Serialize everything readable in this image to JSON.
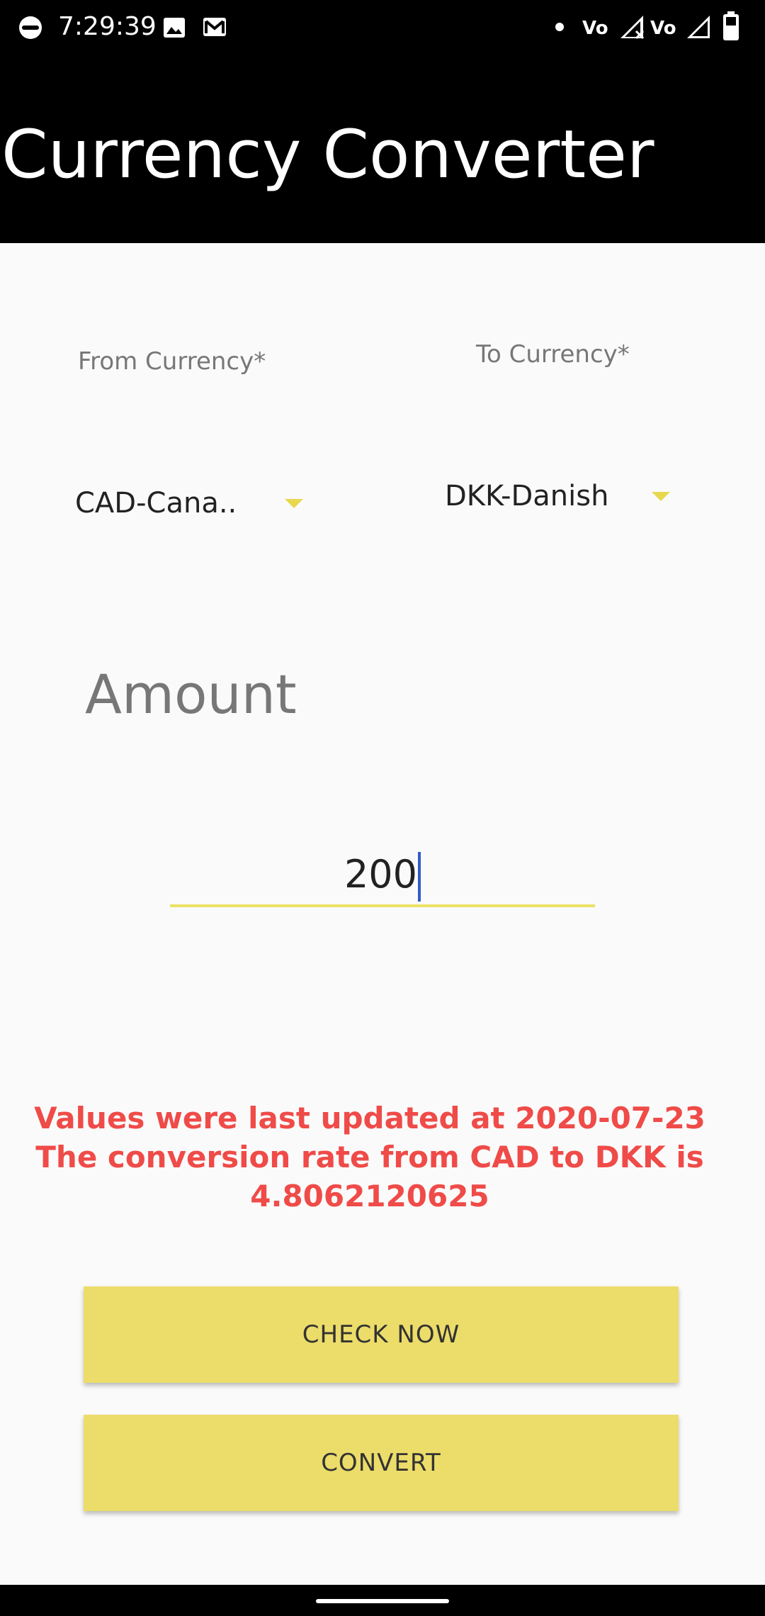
{
  "status_bar": {
    "time": "7:29:39",
    "icons": [
      "incognito-icon",
      "image-icon",
      "gmail-icon",
      "notification-dot-icon",
      "volte-icon",
      "signal-x-icon",
      "volte-icon",
      "signal-icon",
      "battery-icon"
    ]
  },
  "app_bar": {
    "title": "Currency Converter"
  },
  "from_currency": {
    "label": "From Currency*",
    "value": "CAD-Cana.."
  },
  "to_currency": {
    "label": "To Currency*",
    "value": "DKK-Danish"
  },
  "amount": {
    "label": "Amount",
    "value": "200"
  },
  "info": {
    "line1": "Values were last updated at 2020-07-23",
    "line2": "The conversion rate from CAD to DKK is",
    "line3": "4.8062120625"
  },
  "buttons": {
    "check_now": "CHECK NOW",
    "convert": "CONVERT"
  },
  "colors": {
    "accent": "#ecdd6a",
    "error_text": "#ef4b48",
    "app_bar": "#000000"
  }
}
